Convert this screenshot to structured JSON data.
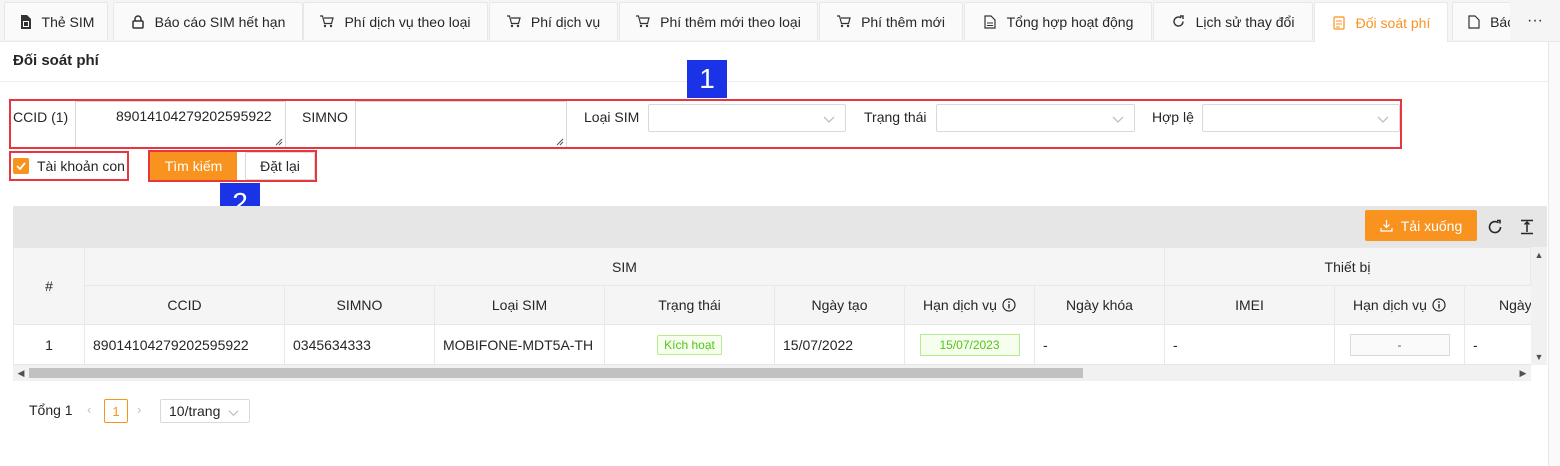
{
  "tabs": [
    {
      "label": "Thẻ SIM",
      "icon": "sim-card-icon"
    },
    {
      "label": "Báo cáo SIM hết hạn",
      "icon": "lock-icon"
    },
    {
      "label": "Phí dịch vụ theo loại",
      "icon": "cart-icon"
    },
    {
      "label": "Phí dịch vụ",
      "icon": "cart-icon"
    },
    {
      "label": "Phí thêm mới theo loại",
      "icon": "cart-icon"
    },
    {
      "label": "Phí thêm mới",
      "icon": "cart-icon"
    },
    {
      "label": "Tổng hợp hoạt động",
      "icon": "file-icon"
    },
    {
      "label": "Lịch sử thay đổi",
      "icon": "refresh-icon"
    },
    {
      "label": "Đối soát phí",
      "icon": "reconcile-icon",
      "active": true
    },
    {
      "label": "Báo",
      "icon": "file-icon"
    }
  ],
  "tabs_more": "···",
  "page_title": "Đối soát phí",
  "filters": {
    "ccid_label": "CCID (1)",
    "ccid_value": "89014104279202595922",
    "simno_label": "SIMNO",
    "simno_value": "",
    "sim_type_label": "Loại SIM",
    "status_label": "Trạng thái",
    "valid_label": "Hợp lệ",
    "sub_account_label": "Tài khoản con",
    "sub_account_checked": true
  },
  "buttons": {
    "search": "Tìm kiếm",
    "reset": "Đặt lại",
    "download": "Tải xuống"
  },
  "annotations": [
    "1",
    "2"
  ],
  "table": {
    "group_headers": {
      "index": "#",
      "sim": "SIM",
      "device": "Thiết bị"
    },
    "columns": [
      "CCID",
      "SIMNO",
      "Loại SIM",
      "Trạng thái",
      "Ngày tạo",
      "Hạn dịch vụ",
      "Ngày khóa",
      "IMEI",
      "Hạn dịch vụ",
      "Ngày"
    ],
    "rows": [
      {
        "index": "1",
        "ccid": "89014104279202595922",
        "simno": "0345634333",
        "sim_type": "MOBIFONE-MDT5A-TH",
        "status": "Kích hoạt",
        "created": "15/07/2022",
        "service_expiry": "15/07/2023",
        "lock_date": "-",
        "imei": "-",
        "device_expiry": "-",
        "device_date": "-"
      }
    ]
  },
  "pagination": {
    "total_label": "Tổng 1",
    "current_page": "1",
    "page_size": "10/trang"
  },
  "colors": {
    "accent": "#f7931e",
    "annotation_box": "#e8363f",
    "annotation_badge": "#1a33e6",
    "status_green": "#52c41a"
  }
}
